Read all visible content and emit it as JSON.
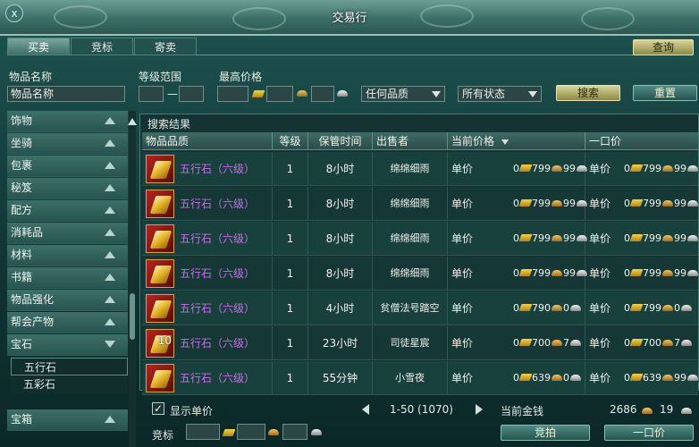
{
  "window": {
    "title": "交易行",
    "close_icon": "x"
  },
  "tabs": [
    {
      "label": "买卖"
    },
    {
      "label": "竞标"
    },
    {
      "label": "寄卖"
    }
  ],
  "query_button": "查询",
  "search": {
    "name_label": "物品名称",
    "name_value": "物品名称",
    "level_label": "等级范围",
    "max_price_label": "最高价格",
    "quality_select": "任何品质",
    "status_select": "所有状态",
    "search_button": "搜索",
    "reset_button": "重置"
  },
  "sidebar": {
    "categories": [
      {
        "label": "饰物"
      },
      {
        "label": "坐骑"
      },
      {
        "label": "包裹"
      },
      {
        "label": "秘笈"
      },
      {
        "label": "配方"
      },
      {
        "label": "消耗品"
      },
      {
        "label": "材料"
      },
      {
        "label": "书籍"
      },
      {
        "label": "物品强化"
      },
      {
        "label": "帮会产物"
      },
      {
        "label": "宝石"
      }
    ],
    "subitems": [
      {
        "label": "五行石"
      },
      {
        "label": "五彩石"
      }
    ],
    "bottom": {
      "label": "宝箱"
    }
  },
  "results": {
    "title": "搜索结果",
    "columns": [
      "物品品质",
      "等级",
      "保管时间",
      "出售者",
      "当前价格",
      "一口价"
    ],
    "rows": [
      {
        "name": "五行石（六级）",
        "count": "",
        "level": "1",
        "time": "8小时",
        "seller": "绵绵细雨",
        "unit": "单价",
        "cur_gold": "0",
        "cur_silver": "799",
        "cur_copper": "99",
        "buy_gold": "0",
        "buy_silver": "799",
        "buy_copper": "99"
      },
      {
        "name": "五行石（六级）",
        "count": "",
        "level": "1",
        "time": "8小时",
        "seller": "绵绵细雨",
        "unit": "单价",
        "cur_gold": "0",
        "cur_silver": "799",
        "cur_copper": "99",
        "buy_gold": "0",
        "buy_silver": "799",
        "buy_copper": "99"
      },
      {
        "name": "五行石（六级）",
        "count": "",
        "level": "1",
        "time": "8小时",
        "seller": "绵绵细雨",
        "unit": "单价",
        "cur_gold": "0",
        "cur_silver": "799",
        "cur_copper": "99",
        "buy_gold": "0",
        "buy_silver": "799",
        "buy_copper": "99"
      },
      {
        "name": "五行石（六级）",
        "count": "",
        "level": "1",
        "time": "8小时",
        "seller": "绵绵细雨",
        "unit": "单价",
        "cur_gold": "0",
        "cur_silver": "799",
        "cur_copper": "99",
        "buy_gold": "0",
        "buy_silver": "799",
        "buy_copper": "99"
      },
      {
        "name": "五行石（六级）",
        "count": "",
        "level": "1",
        "time": "4小时",
        "seller": "贫僧法号踏空",
        "unit": "单价",
        "cur_gold": "0",
        "cur_silver": "790",
        "cur_copper": "0",
        "buy_gold": "0",
        "buy_silver": "799",
        "buy_copper": "0"
      },
      {
        "name": "五行石（六级）",
        "count": "10",
        "level": "1",
        "time": "23小时",
        "seller": "司徒星宸",
        "unit": "单价",
        "cur_gold": "0",
        "cur_silver": "700",
        "cur_copper": "7",
        "buy_gold": "0",
        "buy_silver": "700",
        "buy_copper": "7"
      },
      {
        "name": "五行石（六级）",
        "count": "",
        "level": "1",
        "time": "55分钟",
        "seller": "小雪夜",
        "unit": "单价",
        "cur_gold": "0",
        "cur_silver": "639",
        "cur_copper": "0",
        "buy_gold": "0",
        "buy_silver": "639",
        "buy_copper": "99"
      }
    ]
  },
  "footer": {
    "show_unit_label": "显示单价",
    "checkmark": "✓",
    "page_range": "1-50 (1070)",
    "money_label": "当前金钱",
    "money_gold": "2686",
    "money_silver": "19",
    "bid_label": "竞标",
    "bid_button": "竞拍",
    "buyout_button": "一口价"
  }
}
